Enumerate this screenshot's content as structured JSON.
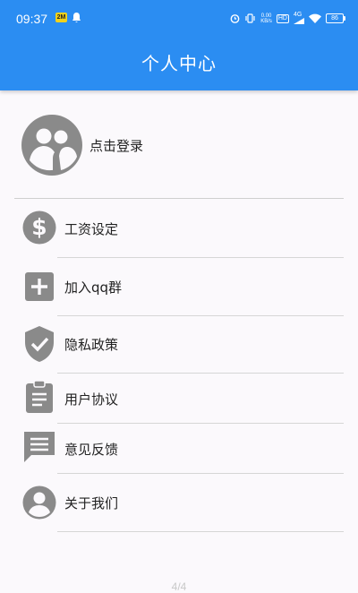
{
  "status_bar": {
    "time": "09:37",
    "left_badge": "2M",
    "net_speed_top": "0.00",
    "net_speed_bottom": "KB/s",
    "hd_label": "HD",
    "network": "4G",
    "battery": "86"
  },
  "header": {
    "title": "个人中心"
  },
  "profile": {
    "login_label": "点击登录"
  },
  "menu": [
    {
      "label": "工资设定",
      "icon": "dollar-circle-icon"
    },
    {
      "label": "加入qq群",
      "icon": "add-box-icon"
    },
    {
      "label": "隐私政策",
      "icon": "shield-check-icon"
    },
    {
      "label": "用户协议",
      "icon": "clipboard-icon"
    },
    {
      "label": "意见反馈",
      "icon": "feedback-chat-icon"
    },
    {
      "label": "关于我们",
      "icon": "account-circle-icon"
    }
  ],
  "page_indicator": "4/4",
  "colors": {
    "primary": "#2b8df2",
    "icon_gray": "#8a8a8a",
    "background": "#fbf9fc"
  }
}
